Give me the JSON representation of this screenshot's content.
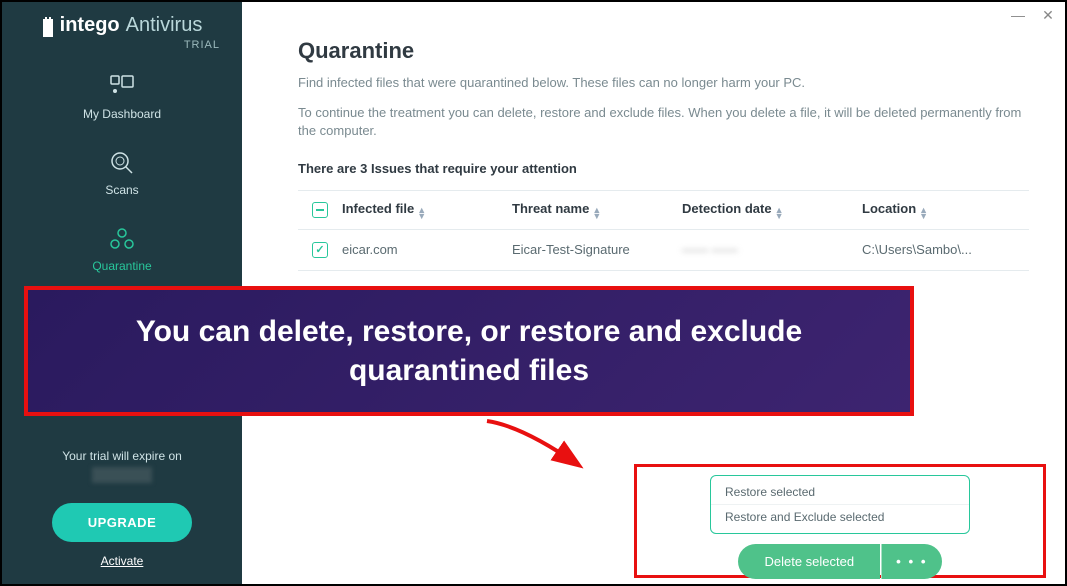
{
  "app": {
    "logo_strong": "intego",
    "logo_light": "Antivirus",
    "trial_label": "TRIAL"
  },
  "sidebar": {
    "items": [
      {
        "label": "My Dashboard"
      },
      {
        "label": "Scans"
      },
      {
        "label": "Quarantine"
      }
    ],
    "trial_expire_text": "Your trial will expire on",
    "upgrade_label": "UPGRADE",
    "activate_label": "Activate"
  },
  "page": {
    "title": "Quarantine",
    "subtitle1": "Find infected files that were quarantined below. These files can no longer harm your PC.",
    "subtitle2": "To continue the treatment you can delete, restore and exclude files. When you delete a file, it will be deleted permanently from the computer.",
    "issues_line": "There are 3 Issues that require your attention"
  },
  "table": {
    "headers": {
      "file": "Infected file",
      "threat": "Threat name",
      "date": "Detection date",
      "location": "Location"
    },
    "rows": [
      {
        "file": "eicar.com",
        "threat": "Eicar-Test-Signature",
        "date": "—— ——",
        "location": "C:\\Users\\Sambo\\..."
      }
    ]
  },
  "annotation": {
    "text": "You can delete, restore, or restore and exclude quarantined files"
  },
  "menu": {
    "restore": "Restore selected",
    "restore_exclude": "Restore and Exclude selected"
  },
  "actions": {
    "delete": "Delete selected",
    "more": "• • •"
  }
}
